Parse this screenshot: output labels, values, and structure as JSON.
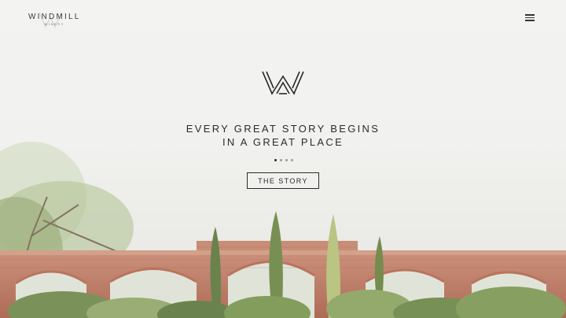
{
  "brand": {
    "name": "WINDMILL",
    "sub": "WINERY"
  },
  "menu": {
    "icon": "hamburger-menu-icon"
  },
  "hero": {
    "logo_icon": "winery-w-monogram-icon",
    "headline_line1": "EVERY GREAT STORY BEGINS",
    "headline_line2": "IN A GREAT PLACE",
    "cta_label": "THE STORY",
    "slides_total": 4,
    "slide_active": 1
  },
  "colors": {
    "text": "#2b2b2b",
    "brick": "#b56a52",
    "foliage": "#7f9a5a"
  }
}
